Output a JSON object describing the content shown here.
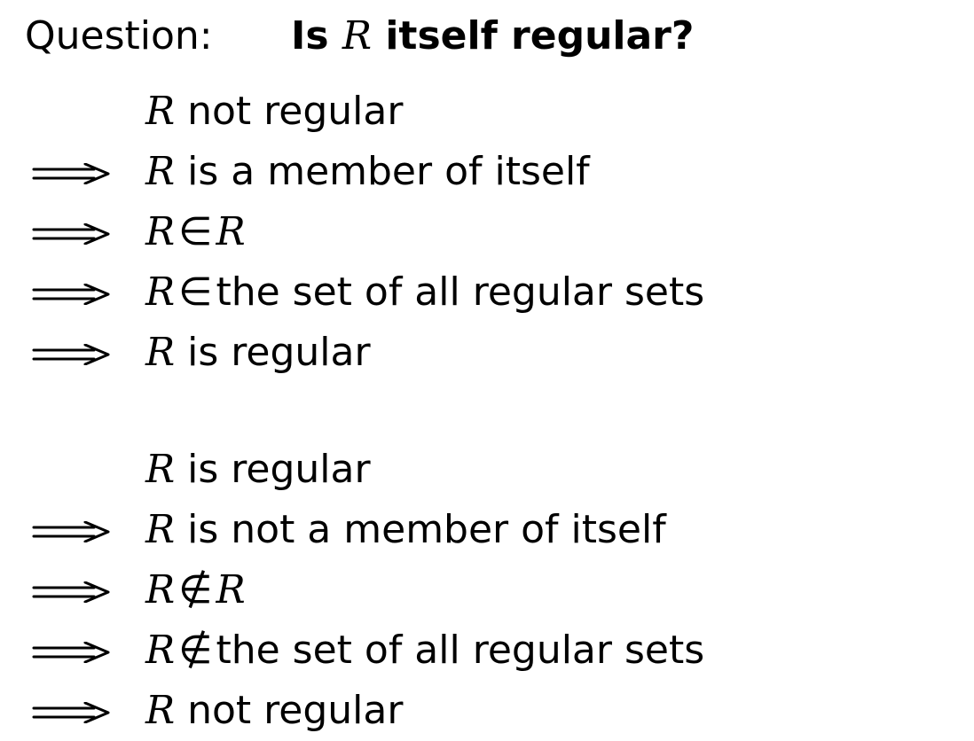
{
  "question": {
    "prefix": "Question:",
    "title_pre": "Is ",
    "title_symbol": "R",
    "title_post": " itself regular?"
  },
  "symbol": "R",
  "symbols": {
    "implies": "⟹",
    "in": "∈",
    "not_in": "∉"
  },
  "block1": {
    "lines": [
      {
        "implies": false,
        "text": "R not regular"
      },
      {
        "implies": true,
        "text": "R is a member of itself"
      },
      {
        "implies": true,
        "text": "R ∈ R"
      },
      {
        "implies": true,
        "text": "R ∈ the set of all regular sets"
      },
      {
        "implies": true,
        "text": "R is regular"
      }
    ]
  },
  "block2": {
    "lines": [
      {
        "implies": false,
        "text": "R is regular"
      },
      {
        "implies": true,
        "text": "R is not a member of itself"
      },
      {
        "implies": true,
        "text": "R ∉ R"
      },
      {
        "implies": true,
        "text": "R ∉ the set of all regular sets"
      },
      {
        "implies": true,
        "text": "R not regular"
      }
    ]
  }
}
